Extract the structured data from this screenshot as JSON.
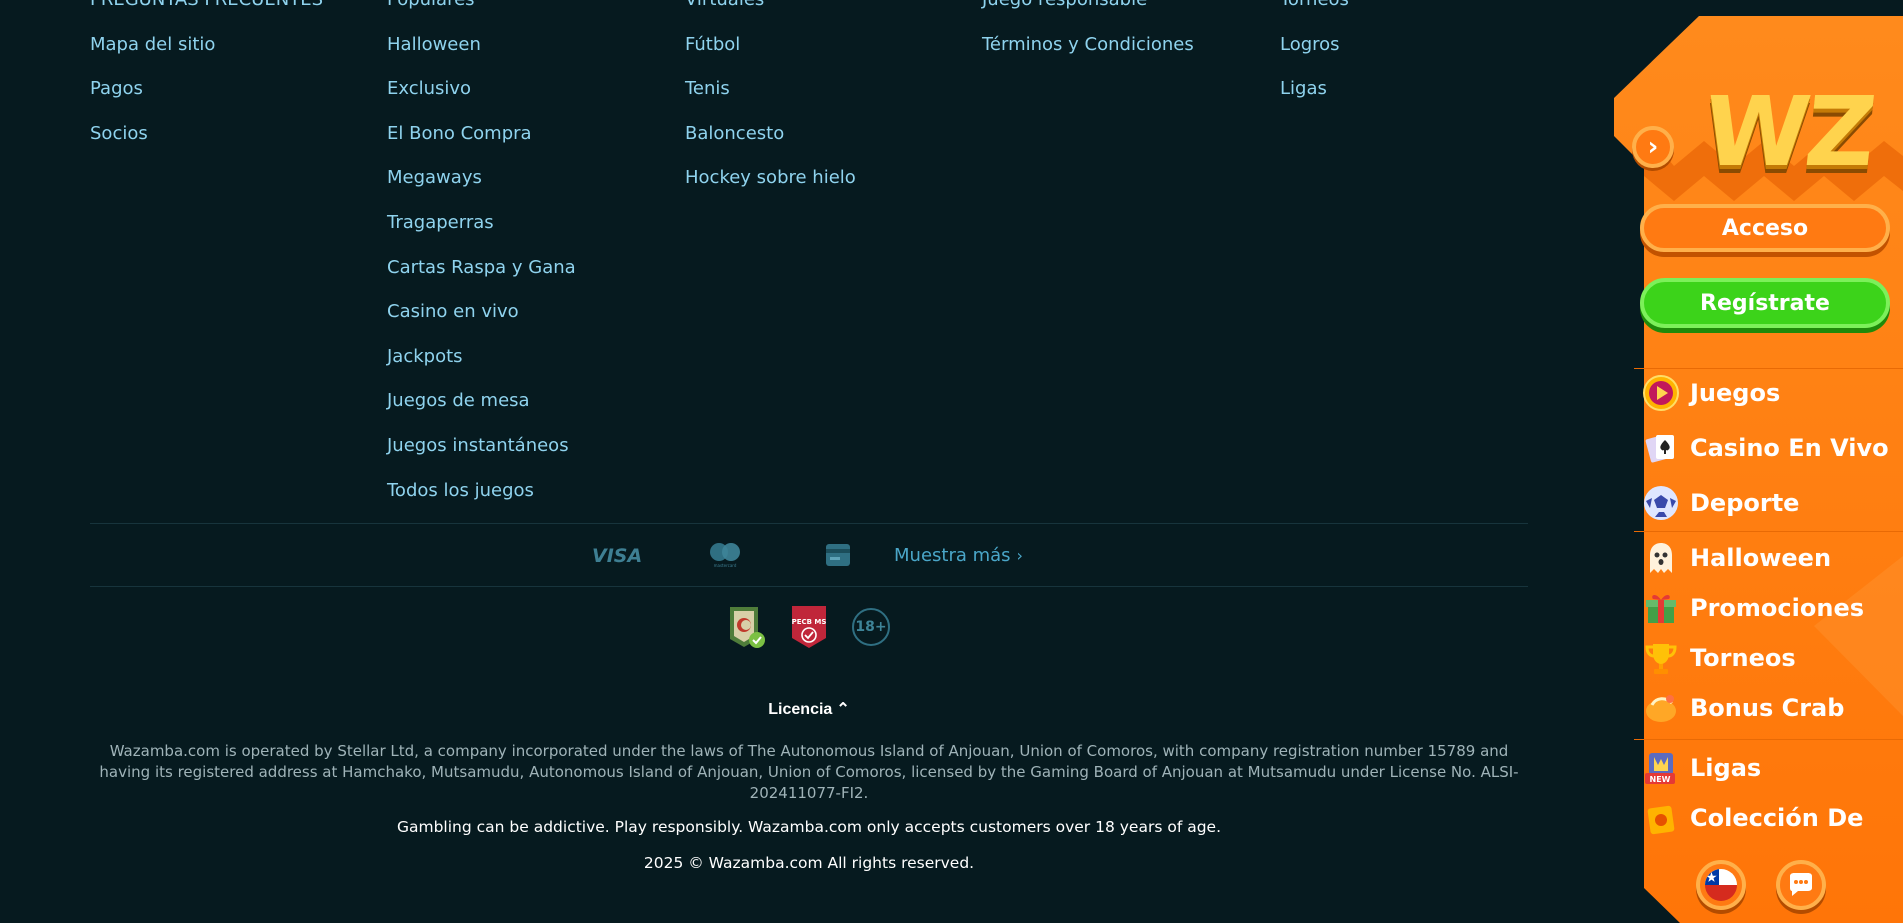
{
  "footer": {
    "columns": [
      [
        "PREGUNTAS FRECUENTES",
        "Mapa del sitio",
        "Pagos",
        "Socios"
      ],
      [
        "Populares",
        "Halloween",
        "Exclusivo",
        "El Bono Compra",
        "Megaways",
        "Tragaperras",
        "Cartas Raspa y Gana",
        "Casino en vivo",
        "Jackpots",
        "Juegos de mesa",
        "Juegos instantáneos",
        "Todos los juegos"
      ],
      [
        "Virtuales",
        "Fútbol",
        "Tenis",
        "Baloncesto",
        "Hockey sobre hielo"
      ],
      [
        "Juego responsable",
        "Términos y Condiciones"
      ],
      [
        "Torneos",
        "Logros",
        "Ligas"
      ]
    ],
    "payments": {
      "visa_label": "VISA",
      "mastercard_label": "mastercard",
      "more_label": "Muestra más"
    },
    "badges": {
      "pecb_label": "PECB MS",
      "age_label": "18+"
    },
    "license_toggle": "Licencia",
    "legal_text": "Wazamba.com is operated by Stellar Ltd, a company incorporated under the laws of The Autonomous Island of Anjouan, Union of Comoros, with company registration number 15789 and having its registered address at Hamchako, Mutsamudu, Autonomous Island of Anjouan, Union of Comoros, licensed by the Gaming Board of Anjouan at Mutsamudu under License No. ALSI-202411077-FI2.",
    "warning_text": "Gambling can be addictive. Play responsibly. Wazamba.com only accepts customers over 18 years of age.",
    "copyright_text": "2025 © Wazamba.com All rights reserved."
  },
  "sidebar": {
    "logo_text": "WZ",
    "login_label": "Acceso",
    "register_label": "Regístrate",
    "nav": [
      {
        "label": "Juegos",
        "icon": "play-icon"
      },
      {
        "label": "Casino En Vivo",
        "icon": "cards-icon"
      },
      {
        "label": "Deporte",
        "icon": "soccer-ball-icon"
      },
      {
        "label": "Halloween",
        "icon": "ghost-icon"
      },
      {
        "label": "Promociones",
        "icon": "gift-icon"
      },
      {
        "label": "Torneos",
        "icon": "trophy-icon"
      },
      {
        "label": "Bonus Crab",
        "icon": "crab-icon"
      },
      {
        "label": "Ligas",
        "icon": "leagues-icon",
        "badge": "NEW"
      },
      {
        "label": "Colección De",
        "icon": "collection-icon"
      }
    ]
  },
  "colors": {
    "background": "#061a1f",
    "link": "#8fd3ee",
    "sidebar_orange": "#ff7a12",
    "register_green": "#3cd31a"
  }
}
